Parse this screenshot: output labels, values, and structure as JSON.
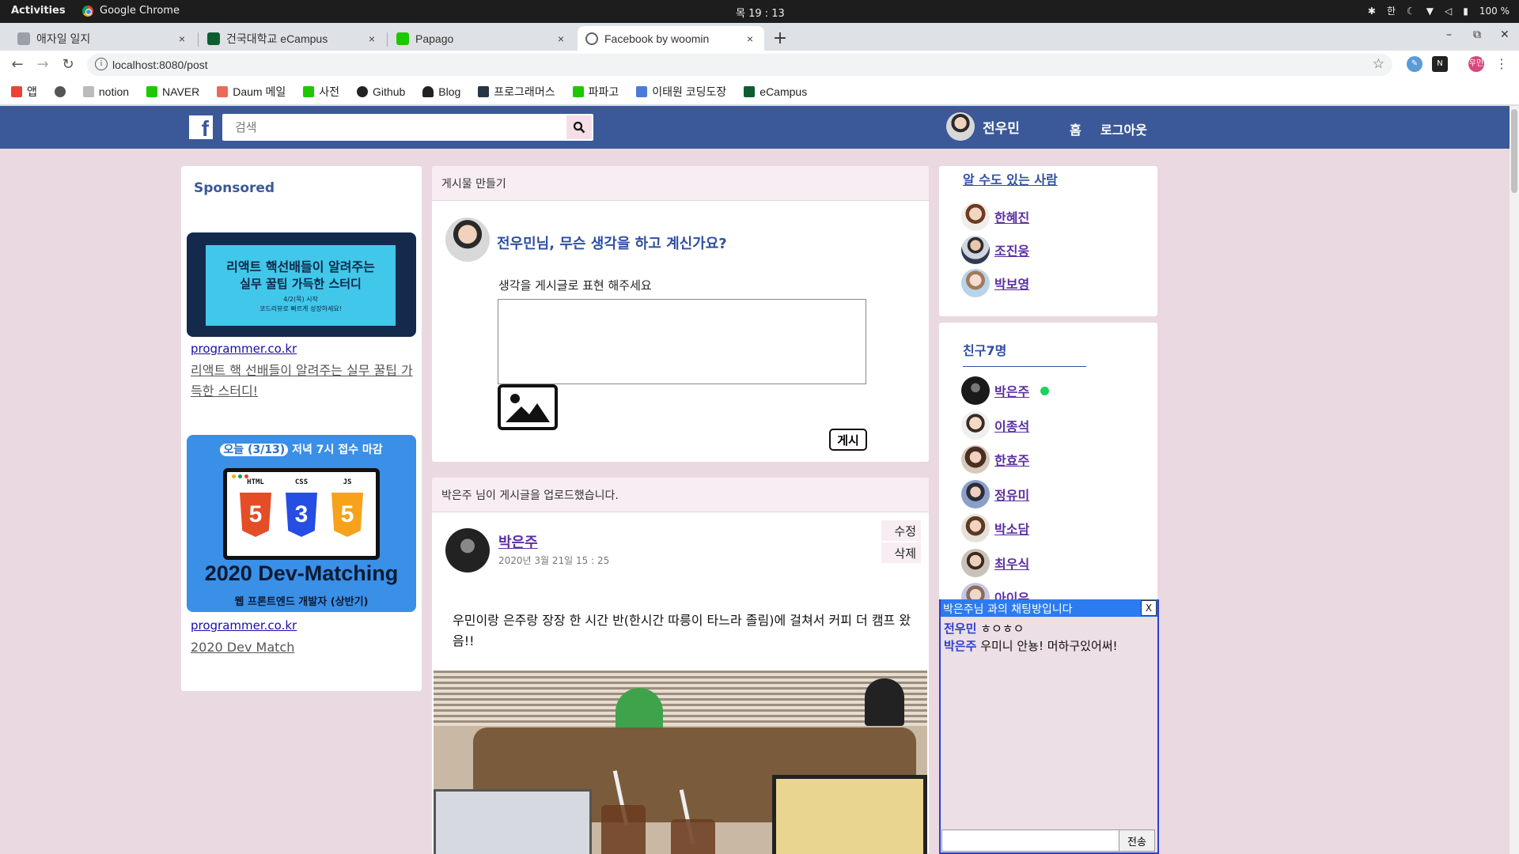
{
  "os": {
    "activities": "Activities",
    "app": "Google Chrome",
    "clock": "목 19 : 13",
    "ime": "한",
    "battery": "100 %"
  },
  "tabs": [
    {
      "title": "애자일 일지",
      "color": "#9aa0a6"
    },
    {
      "title": "건국대학교 eCampus",
      "color": "#0d5e2f"
    },
    {
      "title": "Papago",
      "color": "#1ec800"
    },
    {
      "title": "Facebook by woomin",
      "color": "#5f6368",
      "active": true
    }
  ],
  "tab_close": "×",
  "newtab": "+",
  "address": {
    "url": "localhost:8080/post",
    "info": "i"
  },
  "bookmarks": [
    {
      "label": "앱",
      "color": "#ea4335"
    },
    {
      "label": "",
      "color": "#555555"
    },
    {
      "label": "notion",
      "color": "#bbbbbb"
    },
    {
      "label": "NAVER",
      "color": "#1ec800"
    },
    {
      "label": "Daum 메일",
      "color": "#e96a5a"
    },
    {
      "label": "사전",
      "color": "#1ec800"
    },
    {
      "label": "Github",
      "color": "#222222"
    },
    {
      "label": "Blog",
      "color": "#222222"
    },
    {
      "label": "프로그래머스",
      "color": "#263747"
    },
    {
      "label": "파파고",
      "color": "#1ec800"
    },
    {
      "label": "이태원 코딩도장",
      "color": "#4a7bd8"
    },
    {
      "label": "eCampus",
      "color": "#0d5e2f"
    }
  ],
  "ext_profile": "우민",
  "header": {
    "logo": "f",
    "search_placeholder": "검색",
    "user_name": "전우민",
    "home": "홈",
    "logout": "로그아웃"
  },
  "left": {
    "sponsored": "Sponsored",
    "ad1": {
      "banner_line1": "리액트 핵선배들이 알려주는",
      "banner_line2": "실무 꿀팁 가득한 스터디",
      "banner_line3": "4/2(목) 시작",
      "banner_line4": "코드리뷰로 빠르게 성장하세요!",
      "link": "programmer.co.kr",
      "text": "리액트 핵 선배들이 알려주는 실무 꿀팁 가득한 스터디!"
    },
    "ad2": {
      "badge": "오늘 (3/13)",
      "top": "저녁 7시 접수 마감",
      "html": "HTML",
      "css": "CSS",
      "js": "JS",
      "html_num": "5",
      "css_num": "3",
      "js_num": "5",
      "big": "2020 Dev-Matching",
      "sub": "웹 프론트엔드 개발자 (상반기)",
      "link": "programmer.co.kr",
      "text": "2020 Dev Match"
    }
  },
  "composer": {
    "header": "게시물 만들기",
    "ask": "전우민님, 무슨 생각을 하고 계신가요?",
    "hint": "생각을 게시글로 표현 해주세요",
    "post_button": "게시"
  },
  "post": {
    "header": "박은주 님이 게시글을 업로드했습니다.",
    "author": "박은주",
    "date": "2020년 3월 21일   15 : 25",
    "edit": "수정",
    "delete": "삭제",
    "body": "우민이랑 은주랑 장장 한 시간 반(한시간 따릉이 타느라 졸림)에 걸쳐서 커피 더 캠프 왔음!!"
  },
  "maybe": {
    "title": "알 수도 있는 사람",
    "people": [
      "한혜진",
      "조진웅",
      "박보영"
    ]
  },
  "friends": {
    "title": "친구7명",
    "list": [
      "박은주",
      "이종석",
      "한효주",
      "정유미",
      "박소담",
      "최우식",
      "아이유"
    ]
  },
  "chat": {
    "title": "박은주님 과의 채팅방입니다",
    "close": "X",
    "messages": [
      {
        "who": "전우민",
        "text": "ㅎㅇㅎㅇ"
      },
      {
        "who": "박은주",
        "text": "우미니 안뇽! 머하구있어써!"
      }
    ],
    "send": "전송"
  },
  "colors": {
    "fb_blue": "#3b5998",
    "page_bg": "#ead9e0",
    "link_purple": "#5b2fa0",
    "online": "#1dd15a"
  }
}
